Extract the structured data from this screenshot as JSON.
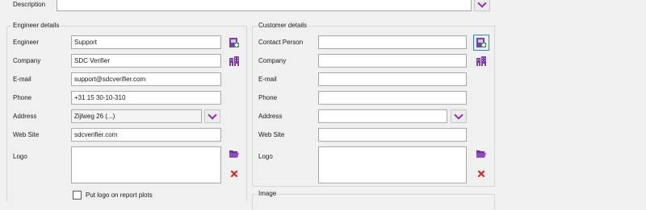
{
  "description": {
    "label": "Description",
    "value": ""
  },
  "engineer": {
    "title": "Engineer details",
    "engineer_label": "Engineer",
    "engineer_value": "Support",
    "company_label": "Company",
    "company_value": "SDC Verifier",
    "email_label": "E-mail",
    "email_value": "support@sdcverifier.com",
    "phone_label": "Phone",
    "phone_value": "+31 15 30-10-310",
    "address_label": "Address",
    "address_value": "Zijlweg 26 (...)",
    "website_label": "Web Site",
    "website_value": "sdcverifier.com",
    "logo_label": "Logo",
    "put_logo_label": "Put logo on report plots",
    "put_logo_checked": false
  },
  "customer": {
    "title": "Customer details",
    "contact_label": "Contact Person",
    "contact_value": "",
    "company_label": "Company",
    "company_value": "",
    "email_label": "E-mail",
    "email_value": "",
    "phone_label": "Phone",
    "phone_value": "",
    "address_label": "Address",
    "address_value": "",
    "website_label": "Web Site",
    "website_value": "",
    "logo_label": "Logo"
  },
  "image": {
    "title": "Image"
  },
  "icons": {
    "contact_picker": "contact-card-icon",
    "building": "building-icon",
    "folder": "folder-open-icon",
    "delete": "delete-x-icon",
    "dropdown": "chevron-down-icon"
  },
  "colors": {
    "accent": "#8a2fb5",
    "delete": "#d12b2b",
    "focus": "#3c7fd1"
  }
}
